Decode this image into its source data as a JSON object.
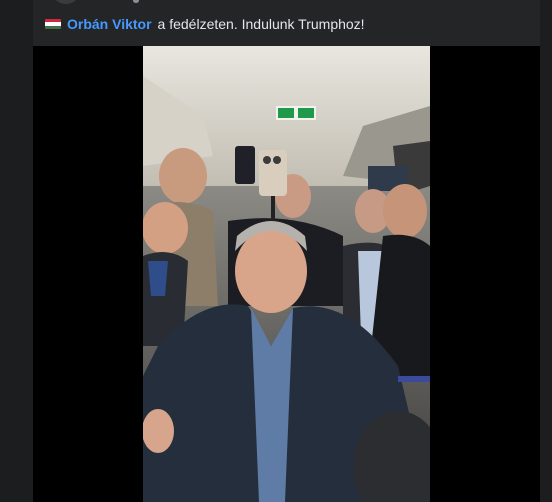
{
  "post": {
    "flag_icon": "hungary-flag-icon",
    "author_mention": "Orbán Viktor",
    "caption_text": "a fedélzeten. Indulunk Trumphoz!"
  },
  "video": {
    "exit_sign_icon": "exit-arrows-icon"
  },
  "colors": {
    "page_bg": "#1c1d1f",
    "card_bg": "#242526",
    "mention": "#4599ff",
    "text": "#e4e6eb",
    "video_bg": "#000000"
  }
}
